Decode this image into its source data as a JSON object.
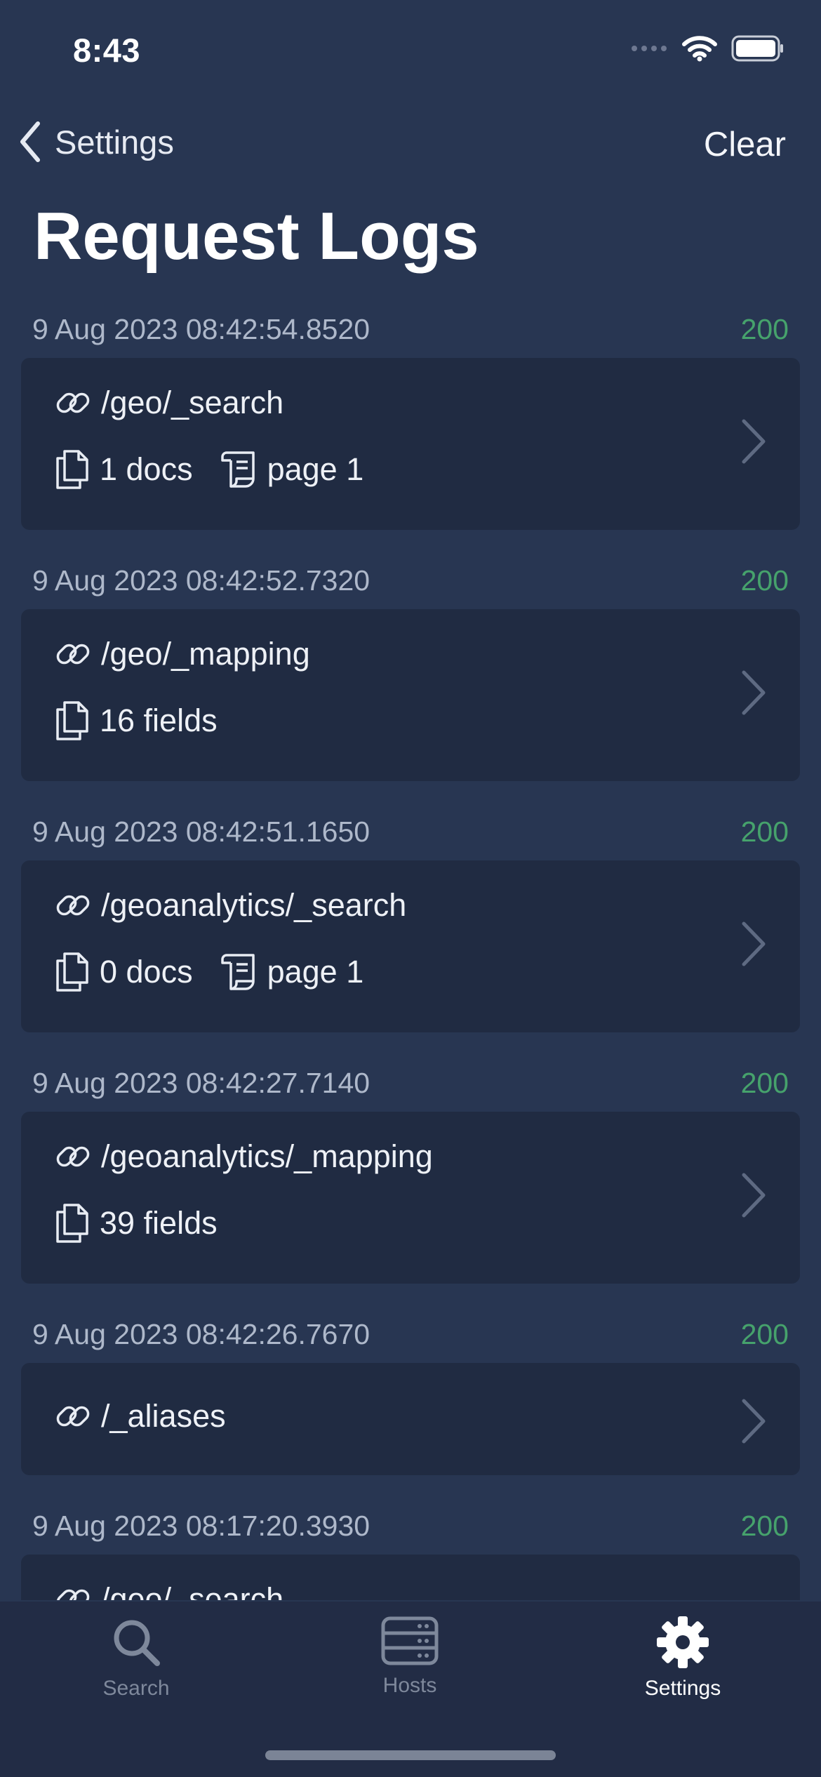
{
  "status_bar": {
    "time": "8:43"
  },
  "nav": {
    "back_label": "Settings",
    "clear_label": "Clear"
  },
  "page": {
    "title": "Request Logs"
  },
  "colors": {
    "background": "#283652",
    "card": "#202b42",
    "status_ok": "#46a26c",
    "tabbar": "#222c45"
  },
  "logs": [
    {
      "timestamp": "9 Aug 2023 08:42:54.8520",
      "status": "200",
      "path": "/geo/_search",
      "detail": "1 docs",
      "page": "page 1"
    },
    {
      "timestamp": "9 Aug 2023 08:42:52.7320",
      "status": "200",
      "path": "/geo/_mapping",
      "detail": "16 fields"
    },
    {
      "timestamp": "9 Aug 2023 08:42:51.1650",
      "status": "200",
      "path": "/geoanalytics/_search",
      "detail": "0 docs",
      "page": "page 1"
    },
    {
      "timestamp": "9 Aug 2023 08:42:27.7140",
      "status": "200",
      "path": "/geoanalytics/_mapping",
      "detail": "39 fields"
    },
    {
      "timestamp": "9 Aug 2023 08:42:26.7670",
      "status": "200",
      "path": "/_aliases"
    },
    {
      "timestamp": "9 Aug 2023 08:17:20.3930",
      "status": "200",
      "path": "/geo/_search"
    }
  ],
  "tabs": [
    {
      "label": "Search",
      "icon": "search-icon",
      "active": false
    },
    {
      "label": "Hosts",
      "icon": "server-icon",
      "active": false
    },
    {
      "label": "Settings",
      "icon": "gear-icon",
      "active": true
    }
  ]
}
